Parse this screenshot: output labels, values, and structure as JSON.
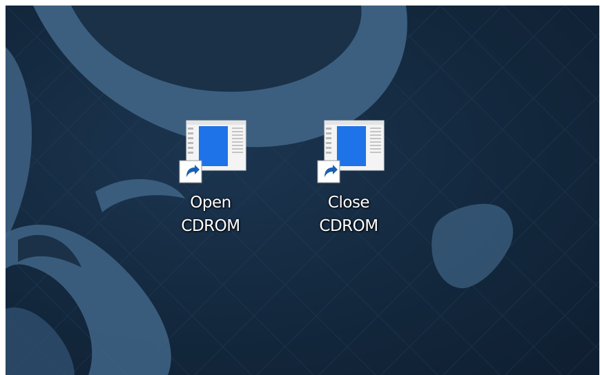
{
  "desktop": {
    "icons": [
      {
        "line1": "Open",
        "line2": "CDROM",
        "icon": "window-app-shortcut-icon"
      },
      {
        "line1": "Close",
        "line2": "CDROM",
        "icon": "window-app-shortcut-icon"
      }
    ]
  },
  "colors": {
    "wallpaper_base": "#142a40",
    "wallpaper_shape": "#3e6283",
    "icon_blue": "#1e73e8",
    "shortcut_arrow": "#1a5fb4"
  }
}
